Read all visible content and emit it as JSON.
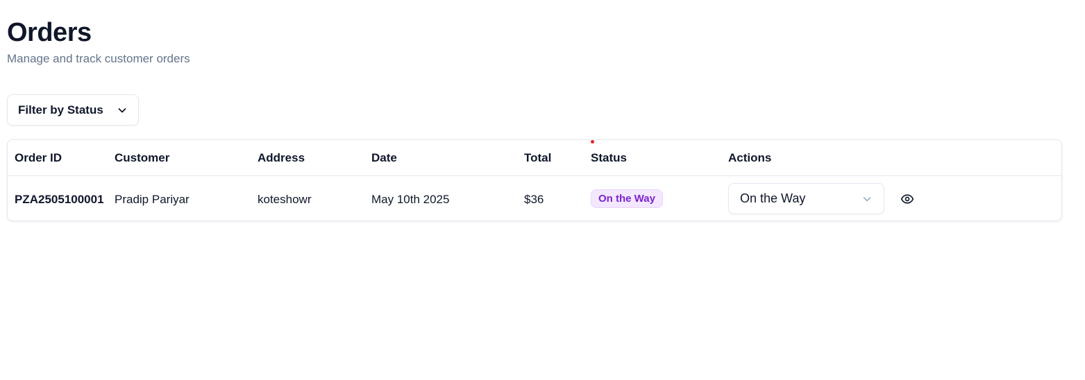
{
  "header": {
    "title": "Orders",
    "subtitle": "Manage and track customer orders"
  },
  "filter": {
    "label": "Filter by Status",
    "icon": "chevron-down-icon"
  },
  "table": {
    "columns": [
      "Order ID",
      "Customer",
      "Address",
      "Date",
      "Total",
      "Status",
      "Actions"
    ],
    "rows": [
      {
        "order_id": "PZA2505100001",
        "customer": "Pradip Pariyar",
        "address": "koteshowr",
        "date": "May 10th 2025",
        "total": "$36",
        "status": "On the Way",
        "status_select": "On the Way",
        "view_icon": "eye-icon"
      }
    ]
  },
  "colors": {
    "badge_bg": "#f3e8ff",
    "badge_text": "#7e22ce",
    "indicator_dot": "#dc2626"
  }
}
